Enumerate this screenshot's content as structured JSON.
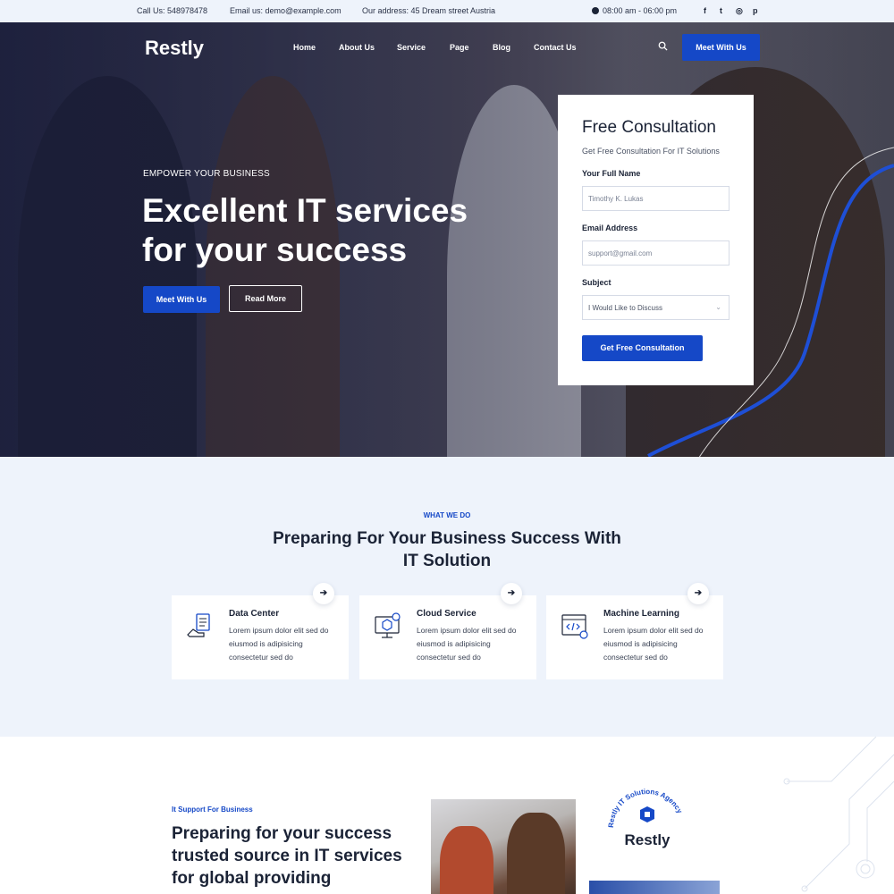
{
  "topbar": {
    "phone": "Call Us: 548978478",
    "email": "Email us: demo@example.com",
    "address": "Our address: 45 Dream street Austria",
    "hours": "08:00 am - 06:00 pm",
    "social": [
      {
        "icon": "facebook-icon",
        "glyph": "f"
      },
      {
        "icon": "twitter-icon",
        "glyph": "t"
      },
      {
        "icon": "instagram-icon",
        "glyph": "◎"
      },
      {
        "icon": "pinterest-icon",
        "glyph": "p"
      }
    ]
  },
  "header": {
    "logo": "Restly",
    "nav": [
      "Home",
      "About Us",
      "Service",
      "Page",
      "Blog",
      "Contact Us"
    ],
    "cta": "Meet With Us"
  },
  "hero": {
    "kicker": "EMPOWER YOUR BUSINESS",
    "title": "Excellent IT services for your success",
    "primary_button": "Meet With Us",
    "secondary_button": "Read More"
  },
  "consultation": {
    "title": "Free Consultation",
    "subtitle": "Get Free Consultation For IT Solutions",
    "name_label": "Your Full Name",
    "name_placeholder": "Timothy K. Lukas",
    "email_label": "Email Address",
    "email_placeholder": "support@gmail.com",
    "subject_label": "Subject",
    "subject_value": "I Would Like to Discuss",
    "submit": "Get Free Consultation"
  },
  "what_we_do": {
    "kicker": "WHAT WE DO",
    "title": "Preparing For Your Business Success With IT Solution",
    "services": [
      {
        "title": "Data Center",
        "text": "Lorem ipsum dolor elit sed do eiusmod is adipisicing consectetur sed do",
        "icon": "data-center-icon"
      },
      {
        "title": "Cloud Service",
        "text": "Lorem ipsum dolor elit sed do eiusmod is adipisicing consectetur sed do",
        "icon": "cloud-service-icon"
      },
      {
        "title": "Machine Learning",
        "text": "Lorem ipsum dolor elit sed do eiusmod is adipisicing consectetur sed do",
        "icon": "machine-learning-icon"
      }
    ]
  },
  "support": {
    "kicker": "It Support For Business",
    "title": "Preparing for your success trusted source in IT services for global providing",
    "badge_ring": "Restly IT Solutions Agency",
    "badge_name": "Restly"
  },
  "colors": {
    "accent": "#1548c7",
    "dark": "#1b2336",
    "light_bg": "#eef3fb"
  }
}
